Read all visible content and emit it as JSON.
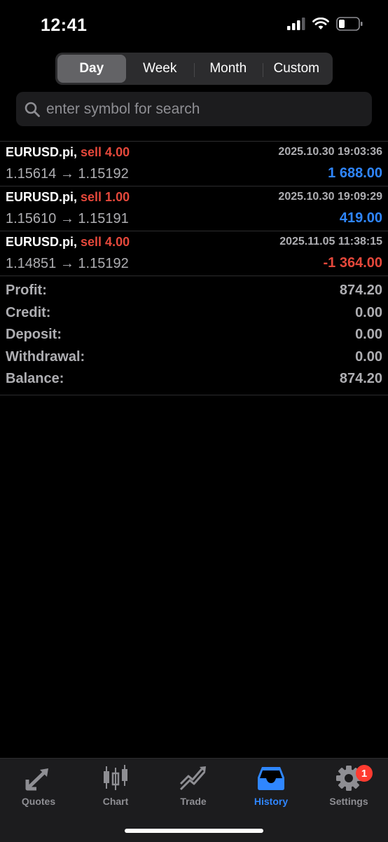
{
  "status_bar": {
    "time": "12:41"
  },
  "period_tabs": [
    {
      "label": "Day",
      "active": true
    },
    {
      "label": "Week",
      "active": false
    },
    {
      "label": "Month",
      "active": false
    },
    {
      "label": "Custom",
      "active": false
    }
  ],
  "search": {
    "placeholder": "enter symbol for search"
  },
  "deals": [
    {
      "symbol": "EURUSD.pi,",
      "side": "sell 4.00",
      "datetime": "2025.10.30 19:03:36",
      "prices": "1.15614 → 1.15192",
      "profit": "1 688.00",
      "profit_sign": "positive"
    },
    {
      "symbol": "EURUSD.pi,",
      "side": "sell 1.00",
      "datetime": "2025.10.30 19:09:29",
      "prices": "1.15610 → 1.15191",
      "profit": "419.00",
      "profit_sign": "positive"
    },
    {
      "symbol": "EURUSD.pi,",
      "side": "sell 4.00",
      "datetime": "2025.11.05 11:38:15",
      "prices": "1.14851 → 1.15192",
      "profit": "-1 364.00",
      "profit_sign": "negative"
    }
  ],
  "summary": [
    {
      "label": "Profit:",
      "value": "874.20"
    },
    {
      "label": "Credit:",
      "value": "0.00"
    },
    {
      "label": "Deposit:",
      "value": "0.00"
    },
    {
      "label": "Withdrawal:",
      "value": "0.00"
    },
    {
      "label": "Balance:",
      "value": "874.20"
    }
  ],
  "tabbar": {
    "items": [
      {
        "label": "Quotes",
        "icon": "quotes-arrows-icon"
      },
      {
        "label": "Chart",
        "icon": "candlestick-chart-icon"
      },
      {
        "label": "Trade",
        "icon": "trade-trend-icon"
      },
      {
        "label": "History",
        "icon": "history-tray-icon",
        "active": true
      },
      {
        "label": "Settings",
        "icon": "gear-icon",
        "badge": "1"
      }
    ]
  },
  "colors": {
    "background": "#000000",
    "accent_blue": "#2f86ff",
    "sell_red": "#e5483b",
    "muted_text": "#aeaeb2",
    "badge_red": "#ff3b30"
  }
}
